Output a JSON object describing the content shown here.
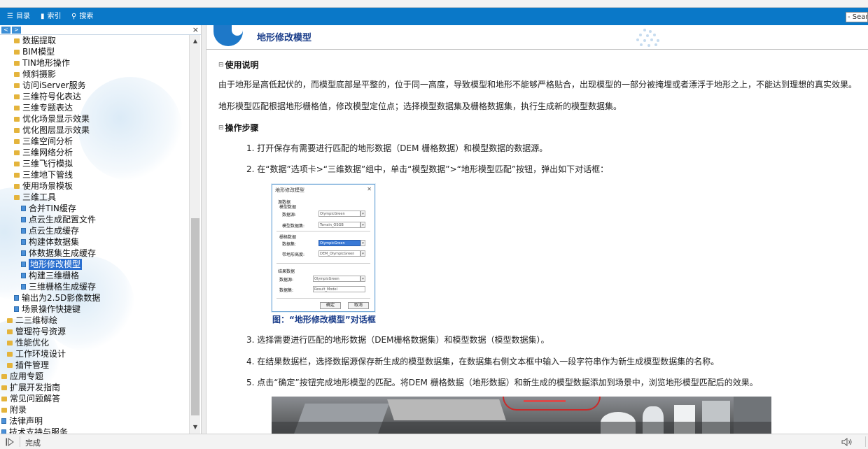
{
  "toolbar": {
    "contents": "目录",
    "index": "索引",
    "search": "搜索",
    "search_box_text": "- Sear",
    "color": "#0a78c8"
  },
  "left_pane": {
    "close": "×",
    "nav_prev": "<",
    "nav_next": ">",
    "tree": [
      {
        "label": "数据提取",
        "type": "folder",
        "level": 1
      },
      {
        "label": "BIM模型",
        "type": "folder",
        "level": 1
      },
      {
        "label": "TIN地形操作",
        "type": "folder",
        "level": 1
      },
      {
        "label": "倾斜摄影",
        "type": "folder",
        "level": 1
      },
      {
        "label": "访问iServer服务",
        "type": "folder",
        "level": 1
      },
      {
        "label": "三维符号化表达",
        "type": "folder",
        "level": 1
      },
      {
        "label": "三维专题表达",
        "type": "folder",
        "level": 1
      },
      {
        "label": "优化场景显示效果",
        "type": "folder",
        "level": 1
      },
      {
        "label": "优化图层显示效果",
        "type": "folder",
        "level": 1
      },
      {
        "label": "三维空间分析",
        "type": "folder",
        "level": 1
      },
      {
        "label": "三维网络分析",
        "type": "folder",
        "level": 1
      },
      {
        "label": "三维飞行模拟",
        "type": "folder",
        "level": 1
      },
      {
        "label": "三维地下管线",
        "type": "folder",
        "level": 1
      },
      {
        "label": "使用场景模板",
        "type": "folder",
        "level": 1
      },
      {
        "label": "三维工具",
        "type": "folder",
        "level": 1
      },
      {
        "label": "合并TIN缓存",
        "type": "page",
        "level": 2
      },
      {
        "label": "点云生成配置文件",
        "type": "page",
        "level": 2
      },
      {
        "label": "点云生成缓存",
        "type": "page",
        "level": 2
      },
      {
        "label": "构建体数据集",
        "type": "page",
        "level": 2
      },
      {
        "label": "体数据集生成缓存",
        "type": "page",
        "level": 2
      },
      {
        "label": "地形修改模型",
        "type": "page",
        "level": 2,
        "selected": true
      },
      {
        "label": "构建三维栅格",
        "type": "page",
        "level": 2
      },
      {
        "label": "三维栅格生成缓存",
        "type": "page",
        "level": 2
      },
      {
        "label": "输出为2.5D影像数据",
        "type": "page",
        "level": 1
      },
      {
        "label": "场景操作快捷键",
        "type": "page",
        "level": 1
      },
      {
        "label": "二三维标绘",
        "type": "folder",
        "level": 0
      },
      {
        "label": "管理符号资源",
        "type": "folder",
        "level": 0
      },
      {
        "label": "性能优化",
        "type": "folder",
        "level": 0
      },
      {
        "label": "工作环境设计",
        "type": "folder",
        "level": 0
      },
      {
        "label": "插件管理",
        "type": "folder",
        "level": 0
      },
      {
        "label": "应用专题",
        "type": "folder",
        "level": -1
      },
      {
        "label": "扩展开发指南",
        "type": "folder",
        "level": -1
      },
      {
        "label": "常见问题解答",
        "type": "folder",
        "level": -1
      },
      {
        "label": "附录",
        "type": "folder",
        "level": -1
      },
      {
        "label": "法律声明",
        "type": "page",
        "level": -1
      },
      {
        "label": "技术支持与服务",
        "type": "page",
        "level": -1
      }
    ]
  },
  "content": {
    "title": "地形修改模型",
    "usage_heading": "使用说明",
    "usage_p1": "由于地形是高低起伏的，而模型底部是平整的，位于同一高度，导致模型和地形不能够严格贴合，出现模型的一部分被掩埋或者漂浮于地形之上，不能达到理想的真实效果。",
    "usage_p2": "地形模型匹配根据地形栅格值，修改模型定位点；选择模型数据集及栅格数据集，执行生成新的模型数据集。",
    "steps_heading": "操作步骤",
    "step1": "1. 打开保存有需要进行匹配的地形数据（DEM 栅格数据）和模型数据的数据源。",
    "step2": "2. 在“数据”选项卡>“三维数据”组中，单击“模型数据”>“地形模型匹配”按钮，弹出如下对话框：",
    "caption": "图：“地形修改模型”对话框",
    "step3": "3. 选择需要进行匹配的地形数据（DEM栅格数据集）和模型数据（模型数据集）。",
    "step4": "4. 在结果数据栏，选择数据源保存新生成的模型数据集，在数据集右侧文本框中输入一段字符串作为新生成模型数据集的名称。",
    "step5": "5. 点击“确定”按钮完成地形模型的匹配。将DEM 栅格数据（地形数据）和新生成的模型数据添加到场景中，浏览地形模型匹配后的效果。"
  },
  "dialog": {
    "title": "地形修改模型",
    "close": "✕",
    "group_source": "源数据",
    "group_model": "模型数据",
    "label_datasource": "数据源:",
    "label_modelset": "模型数据集:",
    "group_raster": "栅格数据",
    "label_dataset": "数据集:",
    "label_dataset2": "带地形高度:",
    "group_result": "结果数据",
    "label_datasource2": "数据源:",
    "label_dataset3": "数据集:",
    "field_ds1": "OlympicGreen",
    "field_model": "Terrain_OSGB",
    "field_raster": "OlympicGreen",
    "field_raster2": "DEM_OlympicGreen",
    "field_ds2": "OlympicGreen",
    "field_name": "Result_Model",
    "ok": "确定",
    "cancel": "取消"
  },
  "status": {
    "text": "完成"
  }
}
